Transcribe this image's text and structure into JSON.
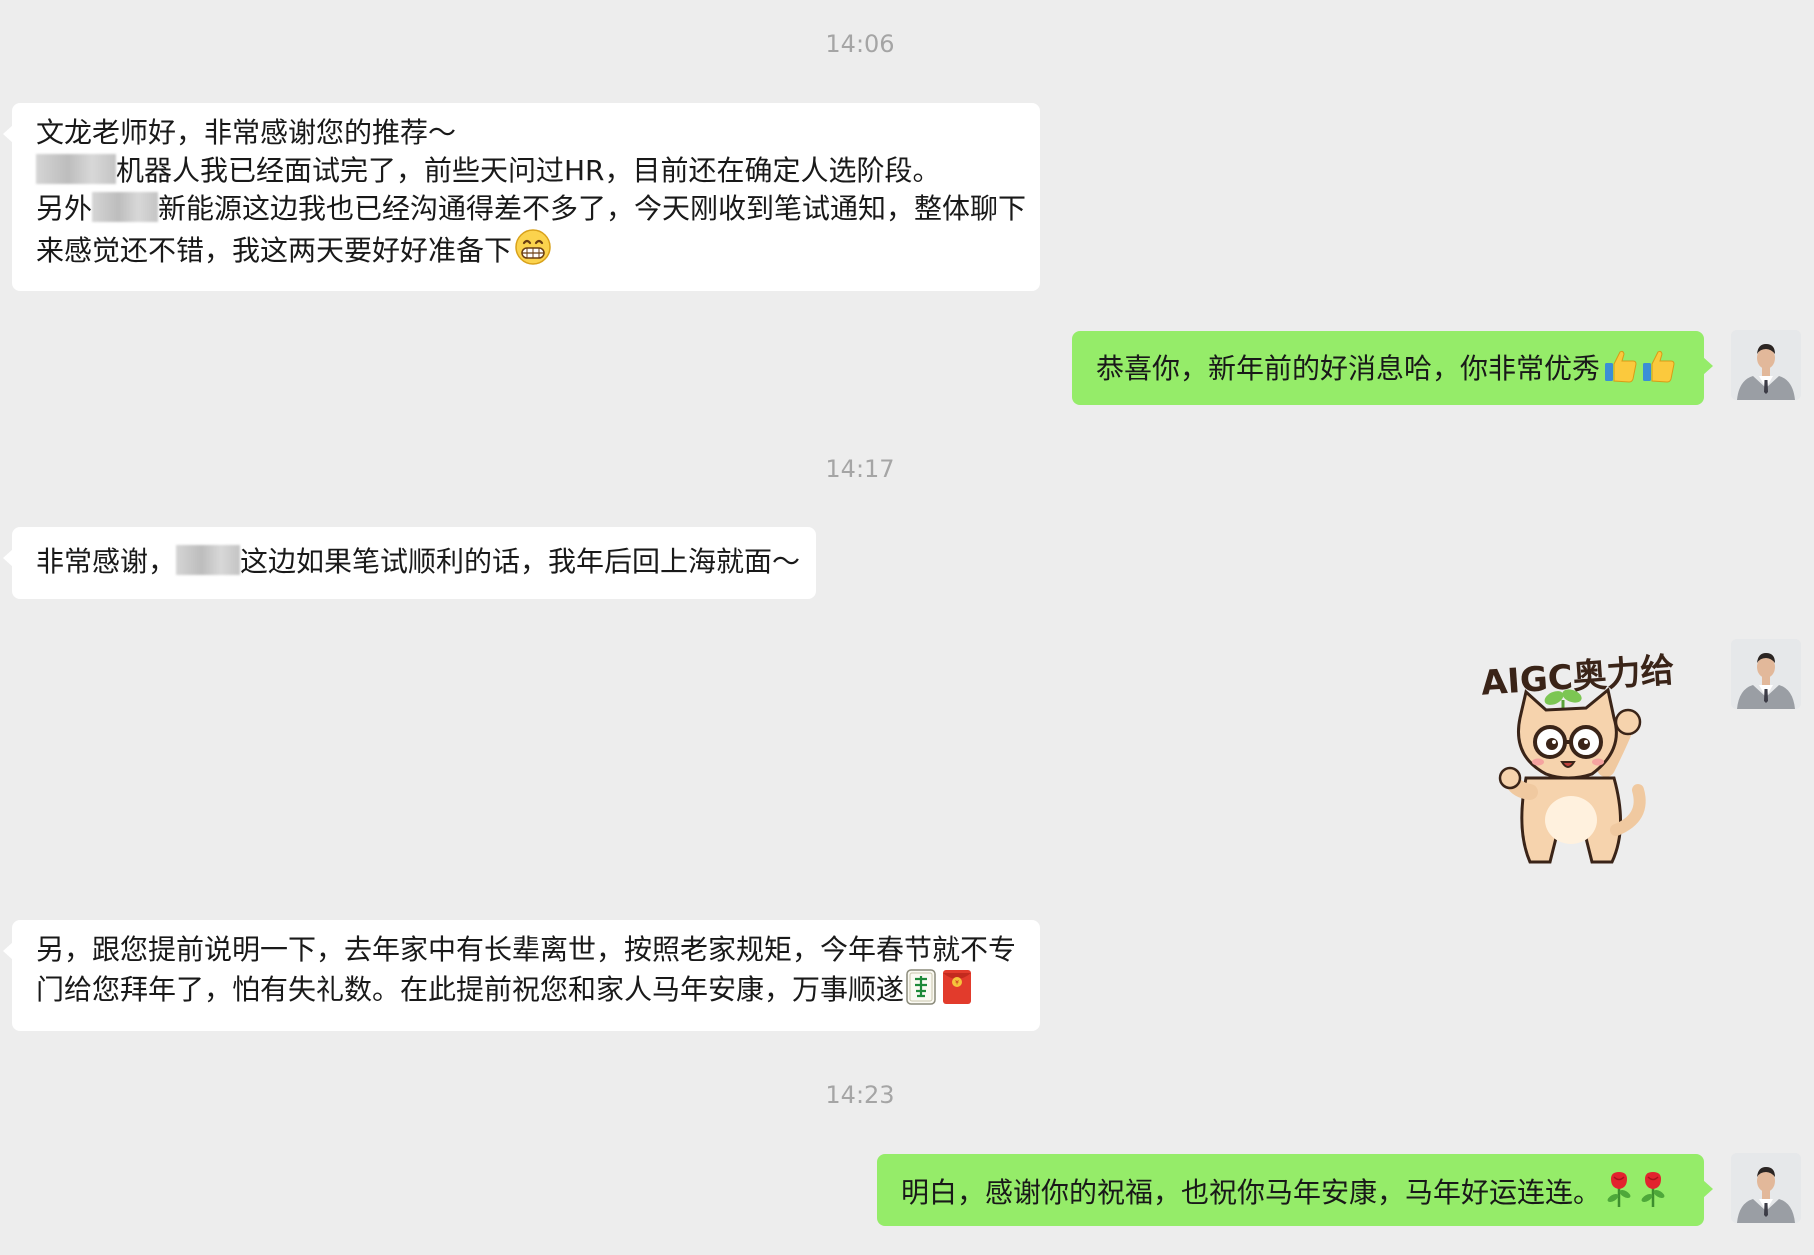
{
  "messages": [
    {
      "type": "time",
      "text": "14:06"
    },
    {
      "type": "received",
      "lines": [
        "文龙老师好，非常感谢您的推荐～",
        "机器人我已经面试完了，前些天问过HR，目前还在确定人选阶段。",
        "另外",
        "新能源这边我也已经沟通得差不多了，今天刚收到笔试通知，整体聊下",
        "来感觉还不错，我这两天要好好准备下"
      ],
      "emoji": "grin-emoji"
    },
    {
      "type": "sent",
      "text": "恭喜你，新年前的好消息哈，你非常优秀",
      "emoji": "thumbs-up-emoji x2"
    },
    {
      "type": "time",
      "text": "14:17"
    },
    {
      "type": "received",
      "text_before": "非常感谢，",
      "text_after": "这边如果笔试顺利的话，我年后回上海就面～"
    },
    {
      "type": "sticker",
      "text": "AIGC奥力给",
      "icon": "cat-with-glasses-sticker"
    },
    {
      "type": "received",
      "lines": [
        "另，跟您提前说明一下，去年家中有长辈离世，按照老家规矩，今年春节就不专",
        "门给您拜年了，怕有失礼数。在此提前祝您和家人马年安康，万事顺遂"
      ],
      "emoji": "mahjong-fa-emoji, red-envelope-emoji"
    },
    {
      "type": "time",
      "text": "14:23"
    },
    {
      "type": "sent",
      "text": "明白，感谢你的祝福，也祝你马年安康，马年好运连连。",
      "emoji": "rose-emoji x2"
    }
  ],
  "colors": {
    "background": "#ededed",
    "received_bubble": "#ffffff",
    "sent_bubble": "#95ec69",
    "timestamp": "#a5a5a5"
  }
}
